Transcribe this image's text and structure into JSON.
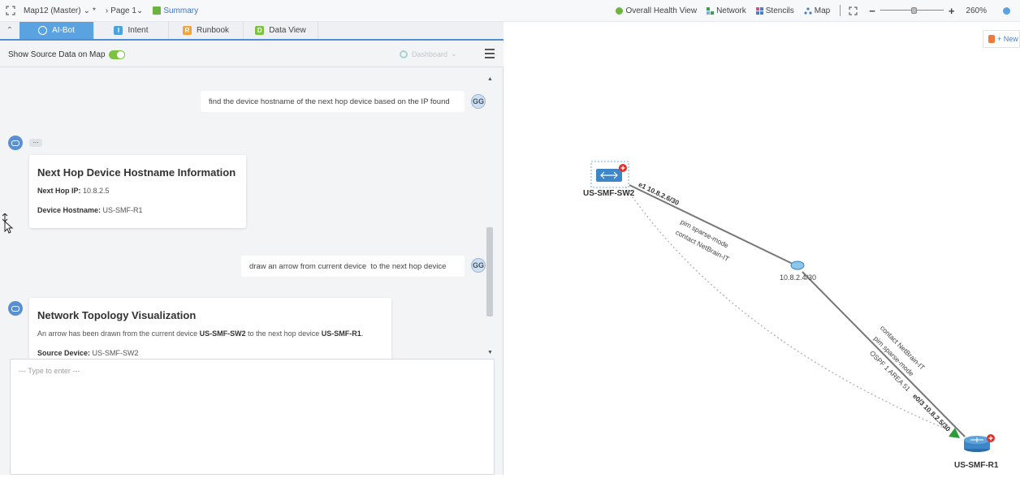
{
  "toolbar": {
    "map_name": "Map12 (Master)",
    "page": "Page 1",
    "summary": "Summary",
    "health": "Overall Health View",
    "network": "Network",
    "stencils": "Stencils",
    "map": "Map",
    "zoom": "260%"
  },
  "tabs": [
    {
      "label": "AI-Bot",
      "letter": ""
    },
    {
      "label": "Intent",
      "letter": "I"
    },
    {
      "label": "Runbook",
      "letter": "R"
    },
    {
      "label": "Data View",
      "letter": "D"
    }
  ],
  "subbar": {
    "show_source": "Show Source Data on Map",
    "dashboard": "Dashboard"
  },
  "chat": {
    "user_msg1": "find the device hostname of the next hop device based on the IP found",
    "user_msg2": "draw an arrow from current device  to the next hop device",
    "avatar_initials": "GG",
    "card1": {
      "title": "Next Hop Device Hostname Information",
      "ip_label": "Next Hop IP:",
      "ip_value": "10.8.2.5",
      "host_label": "Device Hostname:",
      "host_value": "US-SMF-R1"
    },
    "card2": {
      "title": "Network Topology Visualization",
      "line_prefix": "An arrow has been drawn from the current device",
      "current_device": "US-SMF-SW2",
      "line_mid": "to the next hop device",
      "next_device": "US-SMF-R1",
      "line_end": ".",
      "source_label": "Source Device:",
      "source_value": "US-SMF-SW2"
    },
    "input_placeholder": "--- Type to enter ---"
  },
  "map": {
    "new_button": "+ New",
    "device1": "US-SMF-SW2",
    "device2": "US-SMF-R1",
    "subnet_label": "10.8.2.4/30",
    "link1_intf": "e1 10.8.2.6/30",
    "link1_pim": "pim sparse-mode",
    "link1_contact": "contact NetBrain-IT",
    "link2_contact": "contact NetBrain-IT",
    "link2_pim": "pim sparse-mode",
    "link2_ospf": "OSPF 1 AREA 51",
    "link2_intf": "e0/3 10.8.2.5/30"
  },
  "colors": {
    "accent": "#5aa3e0",
    "toggle_on": "#7dc242",
    "arrow": "#2e9b3a",
    "alert": "#d9342b"
  }
}
